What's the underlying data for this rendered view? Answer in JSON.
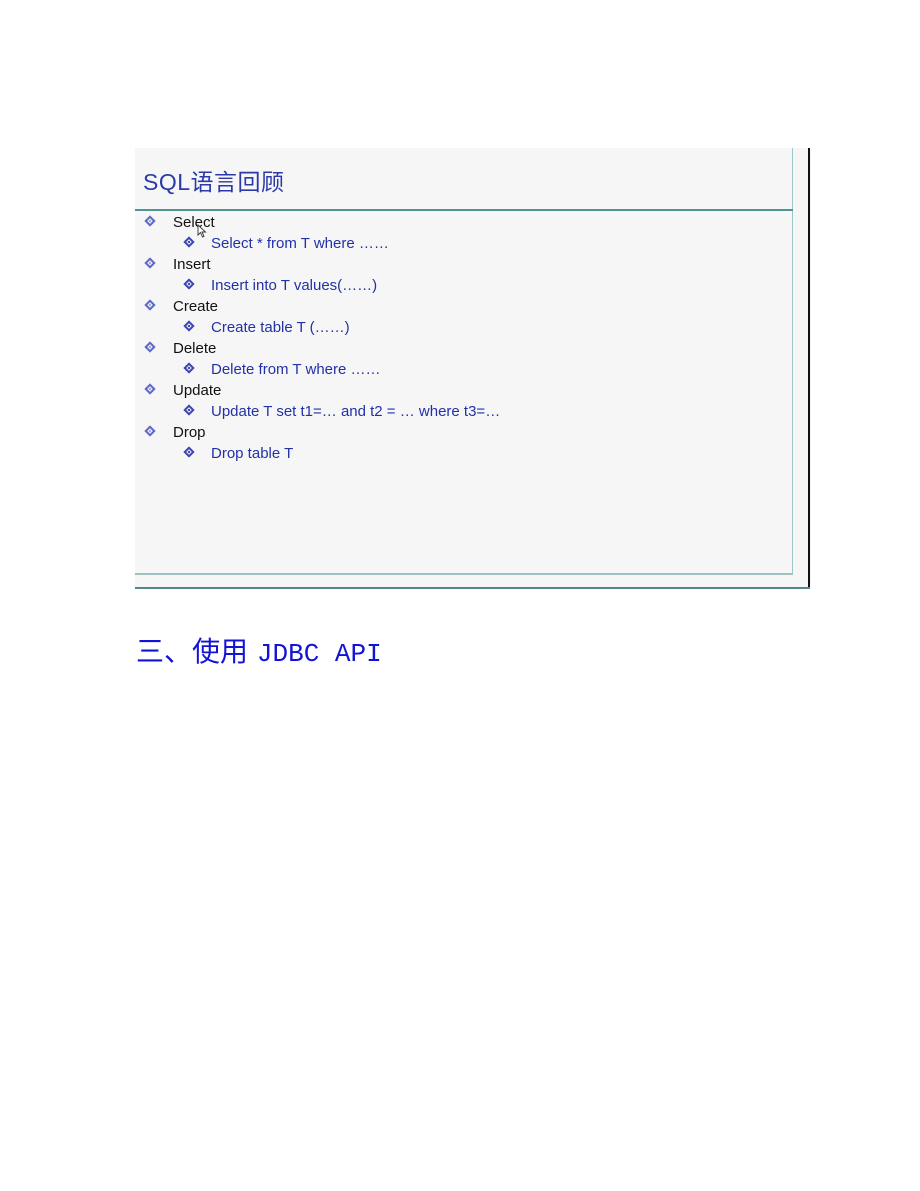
{
  "slide": {
    "title": "SQL语言回顾",
    "items": [
      {
        "label": "Select",
        "sub": "Select * from T where ……"
      },
      {
        "label": "Insert",
        "sub": "Insert into T values(……)"
      },
      {
        "label": "Create",
        "sub": "Create table T (……)"
      },
      {
        "label": "Delete",
        "sub": "Delete from T where ……"
      },
      {
        "label": "Update",
        "sub": "Update T set t1=… and t2 = … where t3=…"
      },
      {
        "label": "Drop",
        "sub": "Drop table T"
      }
    ],
    "bullet_icon": "diamond-bullet-icon",
    "colors": {
      "title": "#2b3aa8",
      "level1_text": "#111111",
      "level2_text": "#2231a8",
      "rule": "#4f9593"
    }
  },
  "document": {
    "heading_prefix": "三、使用 ",
    "heading_suffix": "JDBC API",
    "heading_color": "#1313d6"
  }
}
